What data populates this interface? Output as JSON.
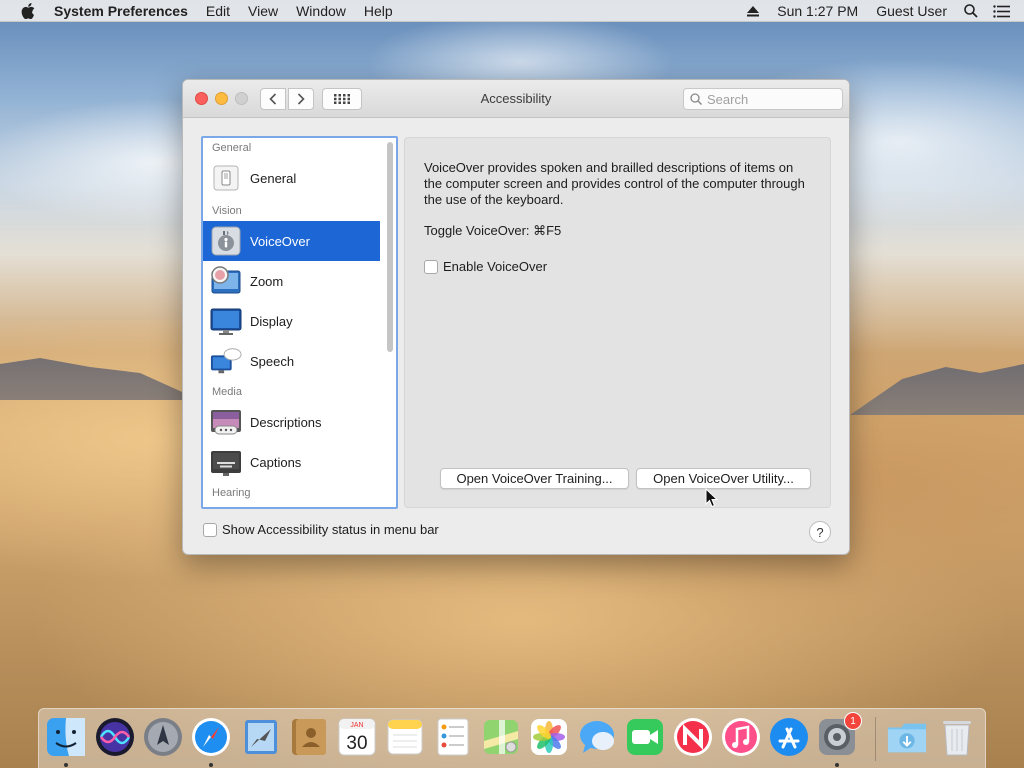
{
  "menubar": {
    "app_name": "System Preferences",
    "items": [
      "Edit",
      "View",
      "Window",
      "Help"
    ],
    "clock": "Sun 1:27 PM",
    "user": "Guest User"
  },
  "window": {
    "title": "Accessibility",
    "search_placeholder": "Search"
  },
  "sidebar": {
    "sections": [
      {
        "heading": "General",
        "items": [
          {
            "label": "General",
            "icon": "general-icon"
          }
        ]
      },
      {
        "heading": "Vision",
        "items": [
          {
            "label": "VoiceOver",
            "icon": "voiceover-icon",
            "selected": true
          },
          {
            "label": "Zoom",
            "icon": "zoom-icon"
          },
          {
            "label": "Display",
            "icon": "display-icon"
          },
          {
            "label": "Speech",
            "icon": "speech-icon"
          }
        ]
      },
      {
        "heading": "Media",
        "items": [
          {
            "label": "Descriptions",
            "icon": "descriptions-icon"
          },
          {
            "label": "Captions",
            "icon": "captions-icon"
          }
        ]
      },
      {
        "heading": "Hearing",
        "items": []
      }
    ]
  },
  "pane": {
    "description": "VoiceOver provides spoken and brailled descriptions of items on the computer screen and provides control of the computer through the use of the keyboard.",
    "toggle_text": "Toggle VoiceOver:  ⌘F5",
    "enable_label": "Enable VoiceOver",
    "training_button": "Open VoiceOver Training...",
    "utility_button": "Open VoiceOver Utility..."
  },
  "footer": {
    "status_label": "Show Accessibility status in menu bar",
    "help": "?"
  },
  "dock": {
    "apps": [
      "Finder",
      "Siri",
      "Launchpad",
      "Safari",
      "Mail",
      "Contacts",
      "Calendar",
      "Notes",
      "Reminders",
      "Maps",
      "Photos",
      "Messages",
      "FaceTime",
      "News",
      "iTunes",
      "App Store",
      "System Preferences"
    ],
    "calendar_month": "JAN",
    "calendar_day": "30",
    "sysprefs_badge": "1"
  }
}
